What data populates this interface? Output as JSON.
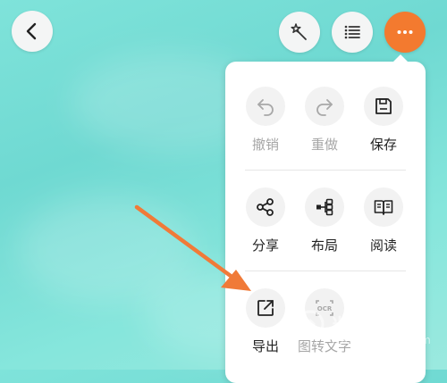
{
  "toolbar": {
    "back_icon": "chevron-left-icon",
    "magic_icon": "magic-wand-icon",
    "outline_icon": "list-icon",
    "more_icon": "more-dots-icon",
    "accent_color": "#f37a2f"
  },
  "menu": {
    "rows": [
      [
        {
          "label": "撤销",
          "icon": "undo-icon",
          "enabled": false
        },
        {
          "label": "重做",
          "icon": "redo-icon",
          "enabled": false
        },
        {
          "label": "保存",
          "icon": "save-icon",
          "enabled": true
        }
      ],
      [
        {
          "label": "分享",
          "icon": "share-icon",
          "enabled": true
        },
        {
          "label": "布局",
          "icon": "layout-icon",
          "enabled": true
        },
        {
          "label": "阅读",
          "icon": "book-icon",
          "enabled": true
        }
      ],
      [
        {
          "label": "导出",
          "icon": "export-icon",
          "enabled": true
        },
        {
          "label": "图转文字",
          "icon": "ocr-icon",
          "enabled": false
        }
      ]
    ],
    "ocr_glyph": "OCR"
  },
  "annotation": {
    "arrow_color": "#f07a38"
  },
  "watermark": {
    "text": "当下软件园",
    "url": "www.downxia.com"
  }
}
